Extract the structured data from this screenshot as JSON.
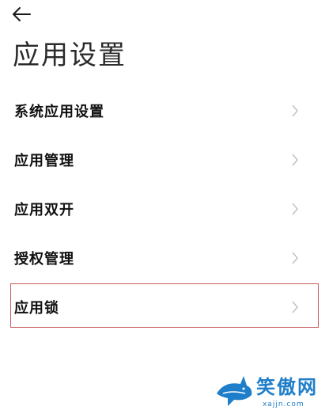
{
  "header": {
    "back_icon": "arrow-left-icon",
    "title": "应用设置"
  },
  "settings": {
    "items": [
      {
        "id": "system-app-settings",
        "label": "系统应用设置",
        "icon": "chevron-right-icon",
        "highlighted": false
      },
      {
        "id": "app-management",
        "label": "应用管理",
        "icon": "chevron-right-icon",
        "highlighted": false
      },
      {
        "id": "dual-apps",
        "label": "应用双开",
        "icon": "chevron-right-icon",
        "highlighted": false
      },
      {
        "id": "permission-management",
        "label": "授权管理",
        "icon": "chevron-right-icon",
        "highlighted": false
      },
      {
        "id": "app-lock",
        "label": "应用锁",
        "icon": "chevron-right-icon",
        "highlighted": true
      }
    ]
  },
  "watermark": {
    "text": "笑傲网",
    "url_text": "xajjn.com",
    "logo": "shark-logo"
  },
  "colors": {
    "highlight_border": "#c9595a",
    "chevron": "#b5b5b5",
    "watermark_blue": "#1f7ec9"
  }
}
